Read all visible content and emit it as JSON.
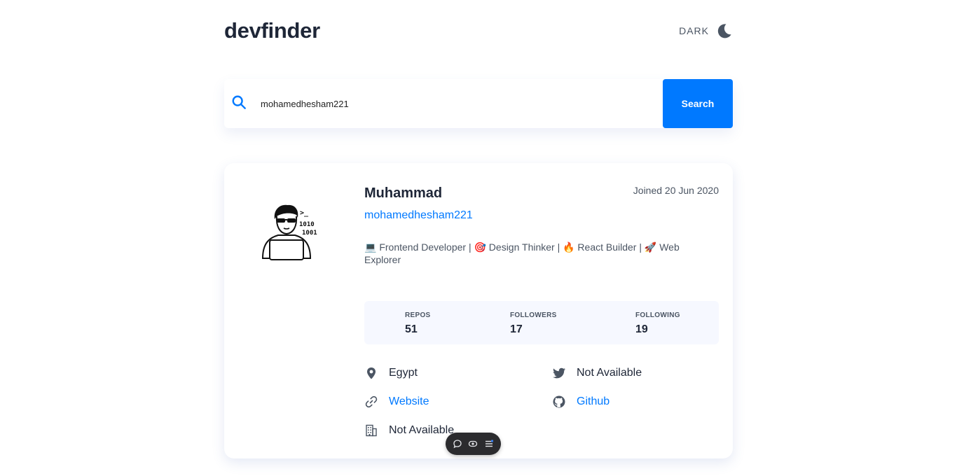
{
  "app": {
    "title": "devfinder"
  },
  "theme": {
    "label": "DARK",
    "icon": "moon-icon"
  },
  "search": {
    "value": "mohamedhesham221",
    "button_label": "Search",
    "icon": "search-icon"
  },
  "profile": {
    "name": "Muhammad",
    "joined": "Joined 20 Jun 2020",
    "login": "mohamedhesham221",
    "bio": "💻 Frontend Developer | 🎯 Design Thinker | 🔥 React Builder | 🚀 Web Explorer",
    "stats": [
      {
        "label": "REPOS",
        "value": "51"
      },
      {
        "label": "FOLLOWERS",
        "value": "17"
      },
      {
        "label": "FOLLOWING",
        "value": "19"
      }
    ],
    "info": {
      "location": "Egypt",
      "twitter": "Not Available",
      "website": "Website",
      "github": "Github",
      "company": "Not Available"
    }
  },
  "colors": {
    "accent": "#0079ff",
    "text": "#1e2637",
    "muted": "#4b5563",
    "stats_bg": "#f6f8ff"
  }
}
